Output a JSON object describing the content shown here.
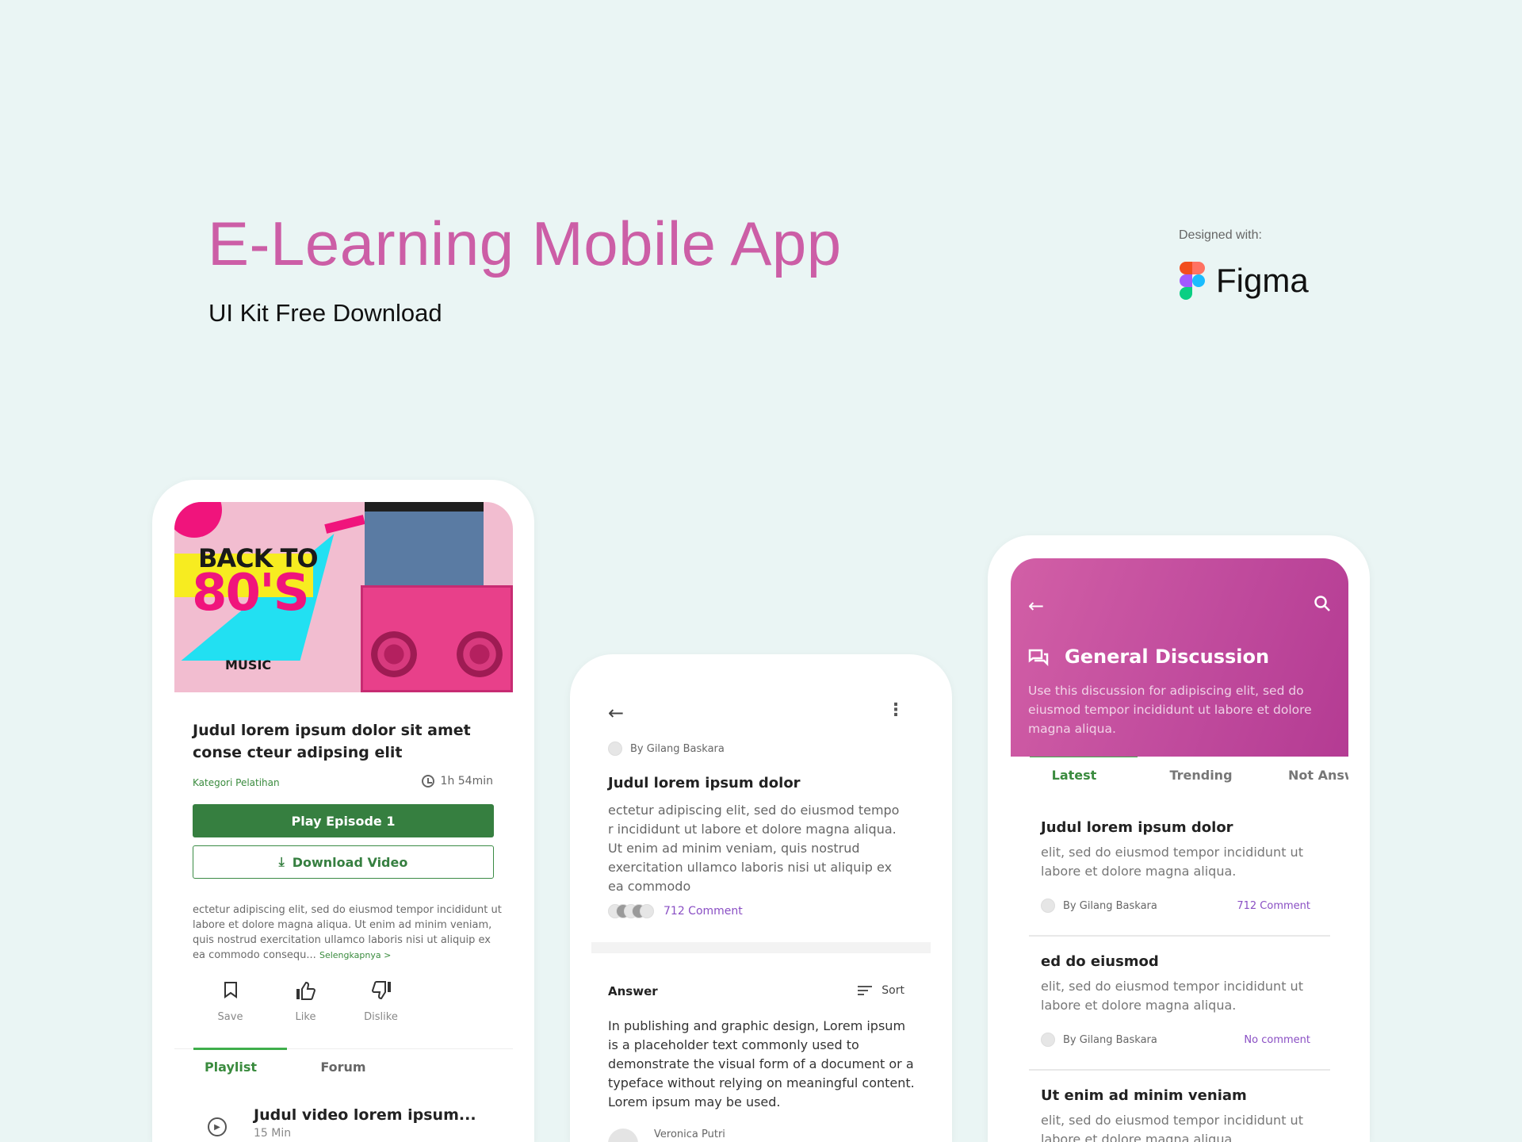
{
  "hero": {
    "title": "E-Learning Mobile App",
    "subtitle": "UI Kit Free Download",
    "designed_with_label": "Designed with:",
    "tool_name": "Figma"
  },
  "colors": {
    "title_pink": "#cc5ea6",
    "primary_green": "#367f40",
    "accent_purple": "#8a4fc4",
    "header_magenta": "#c24d9e",
    "background": "#eaf5f4"
  },
  "course_screen": {
    "banner": {
      "line1": "BACK TO",
      "line2": "80'S",
      "tag": "MUSIC"
    },
    "title": "Judul lorem ipsum dolor sit amet conse cteur adipsing elit",
    "category": "Kategori Pelatihan",
    "duration": "1h 54min",
    "play_button": "Play Episode 1",
    "download_button": "Download Video",
    "description": "ectetur adipiscing elit, sed do eiusmod tempor incididunt ut labore et dolore magna aliqua. Ut enim ad minim veniam, quis nostrud exercitation ullamco laboris nisi ut aliquip ex ea commodo consequ...",
    "read_more": "Selengkapnya >",
    "actions": [
      {
        "label": "Save",
        "icon": "bookmark-icon"
      },
      {
        "label": "Like",
        "icon": "thumbs-up-icon"
      },
      {
        "label": "Dislike",
        "icon": "thumbs-down-icon"
      }
    ],
    "tabs": [
      {
        "label": "Playlist",
        "active": true
      },
      {
        "label": "Forum",
        "active": false
      }
    ],
    "playlist": [
      {
        "title": "Judul video lorem ipsum...",
        "duration": "15 Min"
      }
    ]
  },
  "thread_screen": {
    "author": "By Gilang Baskara",
    "title": "Judul lorem ipsum dolor",
    "body": "ectetur adipiscing elit, sed do eiusmod tempo r incididunt ut labore et dolore magna aliqua. Ut enim ad minim veniam, quis nostrud exercitation ullamco laboris nisi ut aliquip ex ea commodo",
    "comment_count": "712 Comment",
    "answer_label": "Answer",
    "sort_label": "Sort",
    "answer_body": "In publishing and graphic design, Lorem ipsum is a placeholder text commonly used to demonstrate the visual form of a document or a typeface without relying on meaningful content. Lorem ipsum may be used.",
    "answer_author": "Veronica Putri"
  },
  "discussion_screen": {
    "title": "General Discussion",
    "description": "Use this discussion for adipiscing elit, sed do eiusmod tempor incididunt ut labore et dolore magna aliqua.",
    "tabs": [
      {
        "label": "Latest",
        "active": true
      },
      {
        "label": "Trending",
        "active": false
      },
      {
        "label": "Not Answered",
        "active": false
      }
    ],
    "posts": [
      {
        "title": "Judul lorem ipsum dolor",
        "body": "elit, sed do eiusmod tempor incididunt ut labore et dolore magna aliqua.",
        "author": "By Gilang Baskara",
        "comments": "712 Comment"
      },
      {
        "title": "ed do eiusmod",
        "body": "elit, sed do eiusmod tempor incididunt ut labore et dolore magna aliqua.",
        "author": "By Gilang Baskara",
        "comments": "No comment"
      },
      {
        "title": "Ut enim ad minim veniam",
        "body": "elit, sed do eiusmod tempor incididunt ut labore et dolore magna aliqua.",
        "author": "",
        "comments": ""
      }
    ]
  }
}
